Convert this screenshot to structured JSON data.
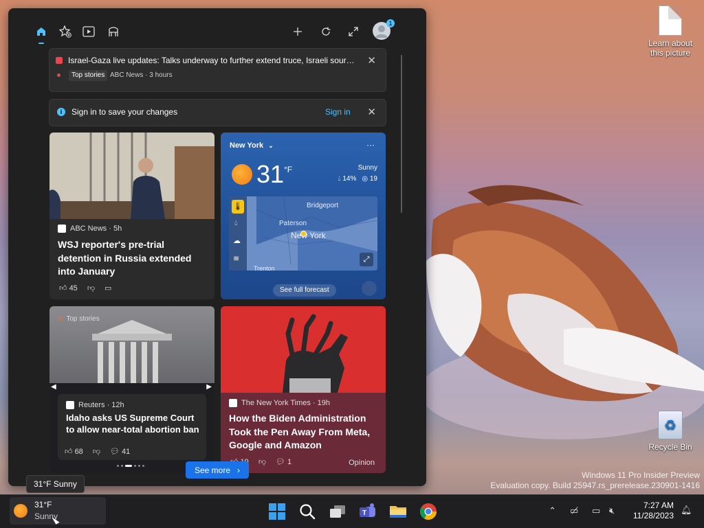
{
  "desktop": {
    "icons": [
      {
        "label": "Learn about this picture"
      },
      {
        "label": "Recycle Bin"
      }
    ],
    "watermark": {
      "line1": "Windows 11 Pro Insider Preview",
      "line2": "Evaluation copy. Build 25947.rs_prerelease.230901-1416"
    }
  },
  "widgets": {
    "toolbar": {
      "icons": [
        "home-icon",
        "star-plus-icon",
        "play-icon",
        "bridge-icon",
        "plus-icon",
        "refresh-icon",
        "expand-icon",
        "profile-icon"
      ],
      "avatar_badge": "1"
    },
    "breaking": {
      "title": "Israel-Gaza live updates: Talks underway to further extend truce, Israeli source...",
      "tag": "Top stories",
      "meta": "ABC News · 3 hours",
      "close": "✕"
    },
    "signin_banner": {
      "text": "Sign in to save your changes",
      "link": "Sign in",
      "close": "✕"
    },
    "cards": [
      {
        "source": "ABC News · 5h",
        "headline": "WSJ reporter's pre-trial detention in Russia extended into January",
        "likes": "45"
      },
      {
        "tag": "Top stories",
        "source": "Reuters · 12h",
        "headline": "Idaho asks US Supreme Court to allow near-total abortion ban",
        "likes": "68",
        "comments": "41"
      },
      {
        "source": "The New York Times · 19h",
        "headline": "How the Biden Administration Took the Pen Away From Meta, Google and Amazon",
        "likes": "19",
        "comments": "1",
        "label": "Opinion"
      }
    ],
    "weather": {
      "location": "New York",
      "menu": "···",
      "temp": "31",
      "unit": "°F",
      "condition": "Sunny",
      "precip": "14%",
      "aqi": "19",
      "map_labels": [
        "Bridgeport",
        "Paterson",
        "New York",
        "Trenton"
      ],
      "forecast_button": "See full forecast"
    },
    "see_more": "See more"
  },
  "tooltip": "31°F Sunny",
  "taskbar": {
    "weather_temp": "31°F",
    "weather_cond": "Sunny",
    "apps": [
      "windows-start-icon",
      "search-icon",
      "task-view-icon",
      "teams-icon",
      "file-explorer-icon",
      "chrome-icon"
    ],
    "time": "7:27 AM",
    "date": "11/28/2023"
  }
}
